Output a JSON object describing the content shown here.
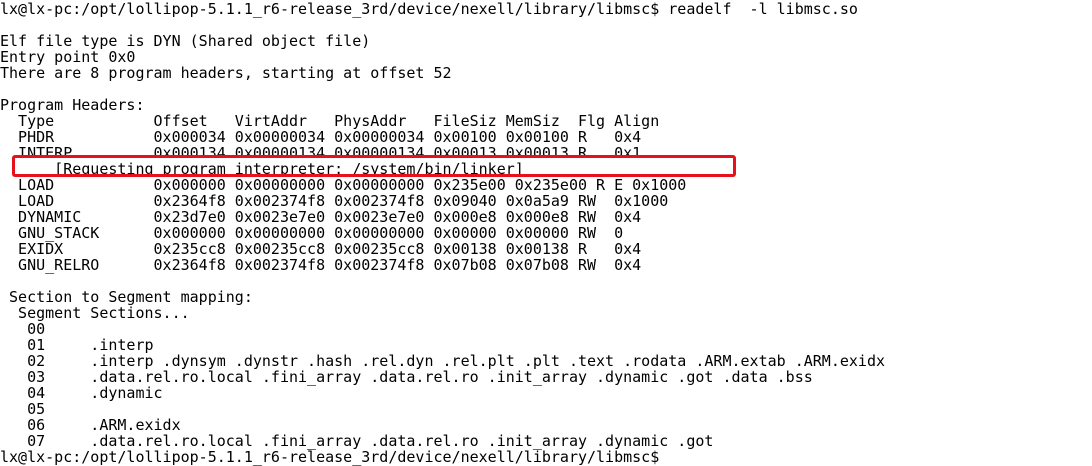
{
  "terminal": {
    "prompt_command": "lx@lx-pc:/opt/lollipop-5.1.1_r6-release_3rd/device/nexell/library/libmsc$ readelf  -l libmsc.so",
    "elf_type": "Elf file type is DYN (Shared object file)",
    "entry_point": "Entry point 0x0",
    "program_headers_summary": "There are 8 program headers, starting at offset 52",
    "program_headers_title": "Program Headers:",
    "header_columns": "  Type           Offset   VirtAddr   PhysAddr   FileSiz MemSiz  Flg Align",
    "rows": [
      "  PHDR           0x000034 0x00000034 0x00000034 0x00100 0x00100 R   0x4",
      "  INTERP         0x000134 0x00000134 0x00000134 0x00013 0x00013 R   0x1",
      "      [Requesting program interpreter: /system/bin/linker]",
      "  LOAD           0x000000 0x00000000 0x00000000 0x235e00 0x235e00 R E 0x1000",
      "  LOAD           0x2364f8 0x002374f8 0x002374f8 0x09040 0x0a5a9 RW  0x1000",
      "  DYNAMIC        0x23d7e0 0x0023e7e0 0x0023e7e0 0x000e8 0x000e8 RW  0x4",
      "  GNU_STACK      0x000000 0x00000000 0x00000000 0x00000 0x00000 RW  0",
      "  EXIDX          0x235cc8 0x00235cc8 0x00235cc8 0x00138 0x00138 R   0x4",
      "  GNU_RELRO      0x2364f8 0x002374f8 0x002374f8 0x07b08 0x07b08 RW  0x4"
    ],
    "section_mapping_title": " Section to Segment mapping:",
    "segment_header": "  Segment Sections...",
    "segments": [
      "   00",
      "   01     .interp",
      "   02     .interp .dynsym .dynstr .hash .rel.dyn .rel.plt .plt .text .rodata .ARM.extab .ARM.exidx",
      "   03     .data.rel.ro.local .fini_array .data.rel.ro .init_array .dynamic .got .data .bss",
      "   04     .dynamic",
      "   05",
      "   06     .ARM.exidx",
      "   07     .data.rel.ro.local .fini_array .data.rel.ro .init_array .dynamic .got"
    ],
    "final_prompt": "lx@lx-pc:/opt/lollipop-5.1.1_r6-release_3rd/device/nexell/library/libmsc$",
    "highlight_color": "#e8111b"
  }
}
